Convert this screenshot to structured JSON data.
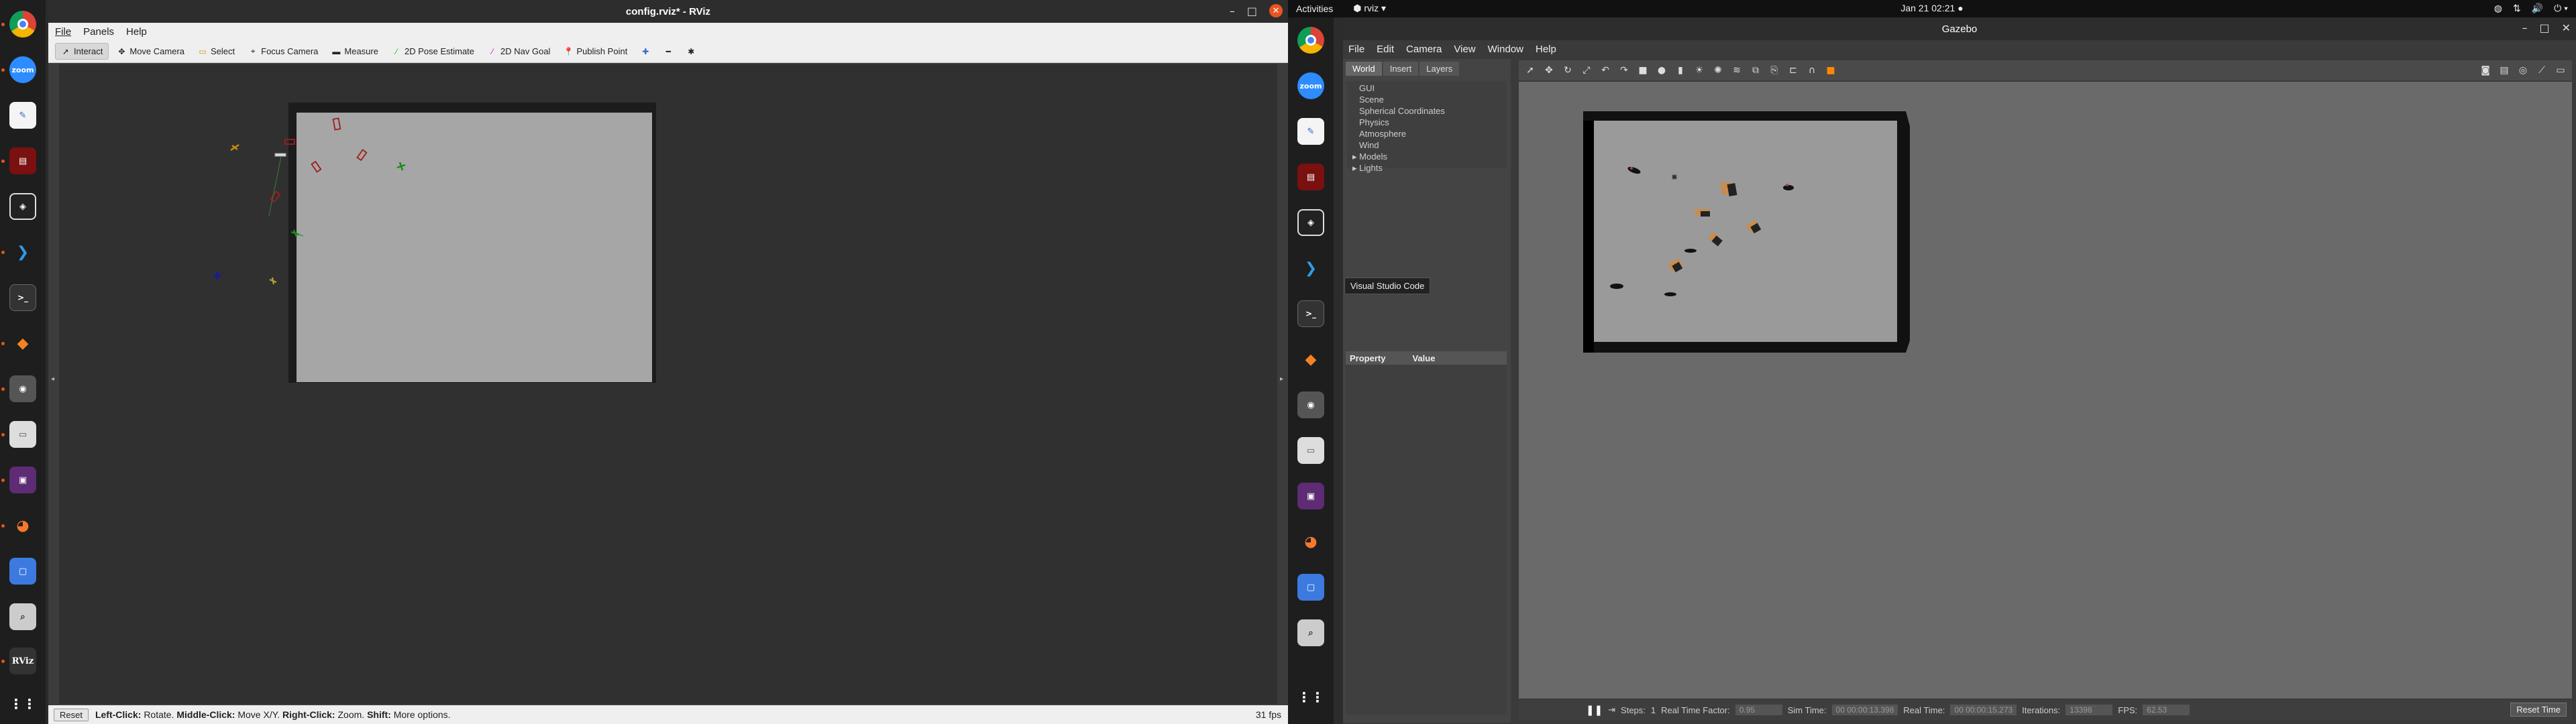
{
  "rviz": {
    "title": "config.rviz* - RViz",
    "menu": [
      "File",
      "Panels",
      "Help"
    ],
    "tools": [
      {
        "label": "Interact",
        "icon": "cursor-icon",
        "active": true
      },
      {
        "label": "Move Camera",
        "icon": "move-camera-icon"
      },
      {
        "label": "Select",
        "icon": "select-icon"
      },
      {
        "label": "Focus Camera",
        "icon": "focus-camera-icon"
      },
      {
        "label": "Measure",
        "icon": "ruler-icon"
      },
      {
        "label": "2D Pose Estimate",
        "icon": "pose-arrow-icon"
      },
      {
        "label": "2D Nav Goal",
        "icon": "goal-arrow-icon"
      },
      {
        "label": "Publish Point",
        "icon": "pin-icon"
      }
    ],
    "status": {
      "reset_label": "Reset",
      "left_click": "Left-Click:",
      "left_click_desc": "Rotate.",
      "middle_click": "Middle-Click:",
      "middle_click_desc": "Move X/Y.",
      "right_click": "Right-Click:",
      "right_click_desc": "Zoom.",
      "shift": "Shift:",
      "shift_desc": "More options.",
      "fps": "31 fps"
    }
  },
  "dock": {
    "items": [
      "chrome-icon",
      "zoom-icon",
      "notes-icon",
      "terminal-red-icon",
      "unity-icon",
      "vscode-icon",
      "terminal-icon",
      "layers-icon",
      "camera-icon",
      "files-icon",
      "video-icon",
      "blender-icon",
      "screenshot-icon",
      "search-icon",
      "rviz-icon",
      "apps-grid-icon"
    ],
    "zoom_label": "zoom",
    "rviz_label": "RViz"
  },
  "topbar": {
    "activities": "Activities",
    "app": "rviz",
    "clock": "Jan 21  02:21"
  },
  "gazebo": {
    "title": "Gazebo",
    "menu": [
      "File",
      "Edit",
      "Camera",
      "View",
      "Window",
      "Help"
    ],
    "tabs": [
      "World",
      "Insert",
      "Layers"
    ],
    "tree": [
      "GUI",
      "Scene",
      "Spherical Coordinates",
      "Physics",
      "Atmosphere",
      "Wind",
      "Models",
      "Lights"
    ],
    "tooltip": "Visual Studio Code",
    "prop_header": [
      "Property",
      "Value"
    ],
    "bottom": {
      "steps_label": "Steps:",
      "steps_value": "1",
      "rtf_label": "Real Time Factor:",
      "rtf_value": "0.95",
      "sim_label": "Sim Time:",
      "sim_value": "00 00:00:13.398",
      "real_label": "Real Time:",
      "real_value": "00 00:00:15.273",
      "iter_label": "Iterations:",
      "iter_value": "13398",
      "fps_label": "FPS:",
      "fps_value": "62.53",
      "reset_label": "Reset Time"
    }
  },
  "colors": {
    "ubuntu_orange": "#e95420",
    "rviz_bg": "#303030",
    "rviz_floor": "#a6a6a6",
    "obstacle_red": "#a11c1c",
    "gazebo_floor": "#9a9a9a"
  }
}
